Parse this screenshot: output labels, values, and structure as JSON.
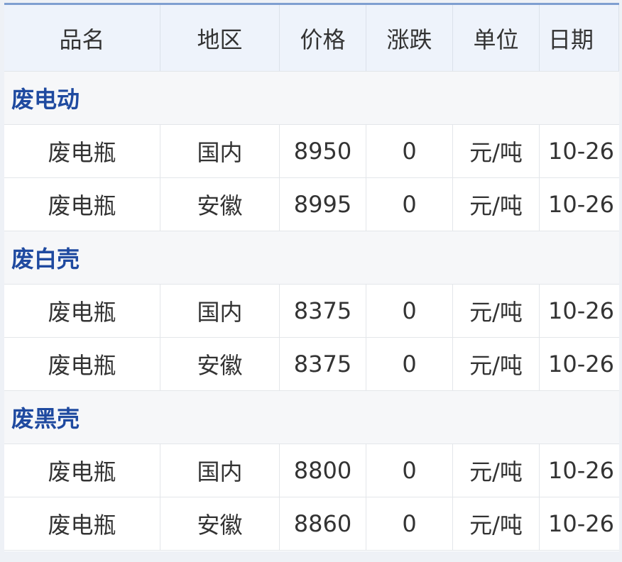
{
  "headers": [
    "品名",
    "地区",
    "价格",
    "涨跌",
    "单位",
    "日期"
  ],
  "groups": [
    {
      "name": "废电动",
      "rows": [
        {
          "product": "废电瓶",
          "region": "国内",
          "price": "8950",
          "change": "0",
          "unit": "元/吨",
          "date": "10-26"
        },
        {
          "product": "废电瓶",
          "region": "安徽",
          "price": "8995",
          "change": "0",
          "unit": "元/吨",
          "date": "10-26"
        }
      ]
    },
    {
      "name": "废白壳",
      "rows": [
        {
          "product": "废电瓶",
          "region": "国内",
          "price": "8375",
          "change": "0",
          "unit": "元/吨",
          "date": "10-26"
        },
        {
          "product": "废电瓶",
          "region": "安徽",
          "price": "8375",
          "change": "0",
          "unit": "元/吨",
          "date": "10-26"
        }
      ]
    },
    {
      "name": "废黑壳",
      "rows": [
        {
          "product": "废电瓶",
          "region": "国内",
          "price": "8800",
          "change": "0",
          "unit": "元/吨",
          "date": "10-26"
        },
        {
          "product": "废电瓶",
          "region": "安徽",
          "price": "8860",
          "change": "0",
          "unit": "元/吨",
          "date": "10-26"
        }
      ]
    }
  ]
}
